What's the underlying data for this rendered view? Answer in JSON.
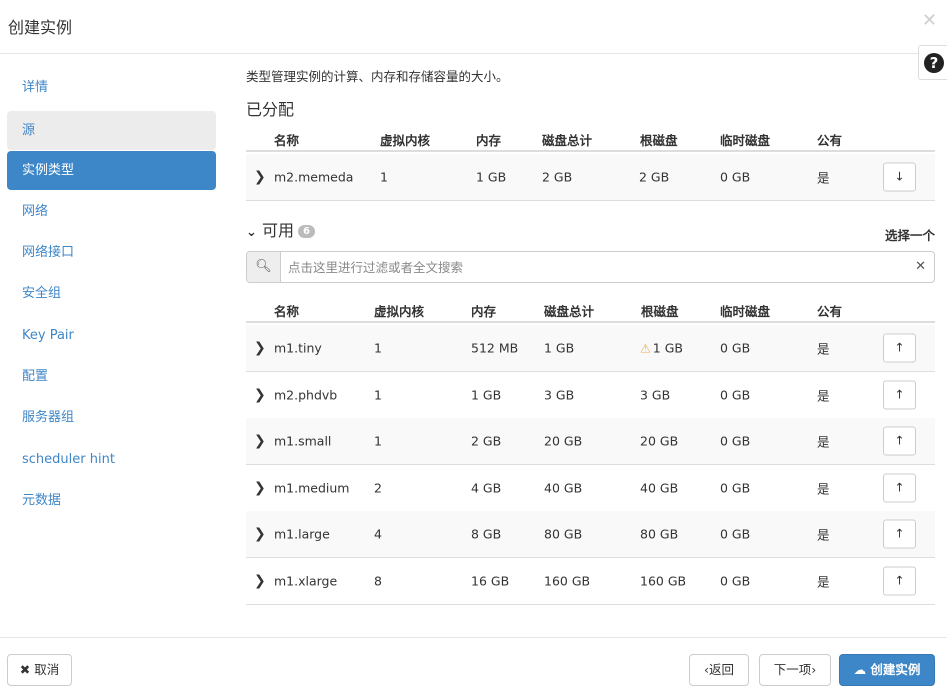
{
  "modal": {
    "title": "创建实例",
    "close": "✕",
    "help": "?"
  },
  "sidebar": {
    "items": [
      {
        "label": "详情"
      },
      {
        "label": "源"
      },
      {
        "label": "实例类型"
      },
      {
        "label": "网络"
      },
      {
        "label": "网络接口"
      },
      {
        "label": "安全组"
      },
      {
        "label": "Key Pair"
      },
      {
        "label": "配置"
      },
      {
        "label": "服务器组"
      },
      {
        "label": "scheduler hint"
      },
      {
        "label": "元数据"
      }
    ]
  },
  "main": {
    "description": "类型管理实例的计算、内存和存储容量的大小。",
    "allocated": {
      "title": "已分配",
      "columns": [
        "名称",
        "虚拟内核",
        "内存",
        "磁盘总计",
        "根磁盘",
        "临时磁盘",
        "公有"
      ],
      "rows": [
        {
          "name": "m2.memeda",
          "vcpus": "1",
          "ram": "1 GB",
          "disk_total": "2 GB",
          "root_disk": "2 GB",
          "ephemeral": "0 GB",
          "public": "是"
        }
      ]
    },
    "available": {
      "title": "可用",
      "count": "6",
      "select_one": "选择一个",
      "search_placeholder": "点击这里进行过滤或者全文搜索",
      "columns": [
        "名称",
        "虚拟内核",
        "内存",
        "磁盘总计",
        "根磁盘",
        "临时磁盘",
        "公有"
      ],
      "rows": [
        {
          "name": "m1.tiny",
          "vcpus": "1",
          "ram": "512 MB",
          "disk_total": "1 GB",
          "root_disk": "1 GB",
          "ephemeral": "0 GB",
          "public": "是",
          "warning": true
        },
        {
          "name": "m2.phdvb",
          "vcpus": "1",
          "ram": "1 GB",
          "disk_total": "3 GB",
          "root_disk": "3 GB",
          "ephemeral": "0 GB",
          "public": "是"
        },
        {
          "name": "m1.small",
          "vcpus": "1",
          "ram": "2 GB",
          "disk_total": "20 GB",
          "root_disk": "20 GB",
          "ephemeral": "0 GB",
          "public": "是"
        },
        {
          "name": "m1.medium",
          "vcpus": "2",
          "ram": "4 GB",
          "disk_total": "40 GB",
          "root_disk": "40 GB",
          "ephemeral": "0 GB",
          "public": "是"
        },
        {
          "name": "m1.large",
          "vcpus": "4",
          "ram": "8 GB",
          "disk_total": "80 GB",
          "root_disk": "80 GB",
          "ephemeral": "0 GB",
          "public": "是"
        },
        {
          "name": "m1.xlarge",
          "vcpus": "8",
          "ram": "16 GB",
          "disk_total": "160 GB",
          "root_disk": "160 GB",
          "ephemeral": "0 GB",
          "public": "是"
        }
      ]
    }
  },
  "footer": {
    "cancel": "取消",
    "back": "返回",
    "next": "下一项",
    "create": "创建实例"
  },
  "colors": {
    "accent": "#3d87c8",
    "link": "#3f86c7",
    "warning": "#f0ad4e"
  }
}
